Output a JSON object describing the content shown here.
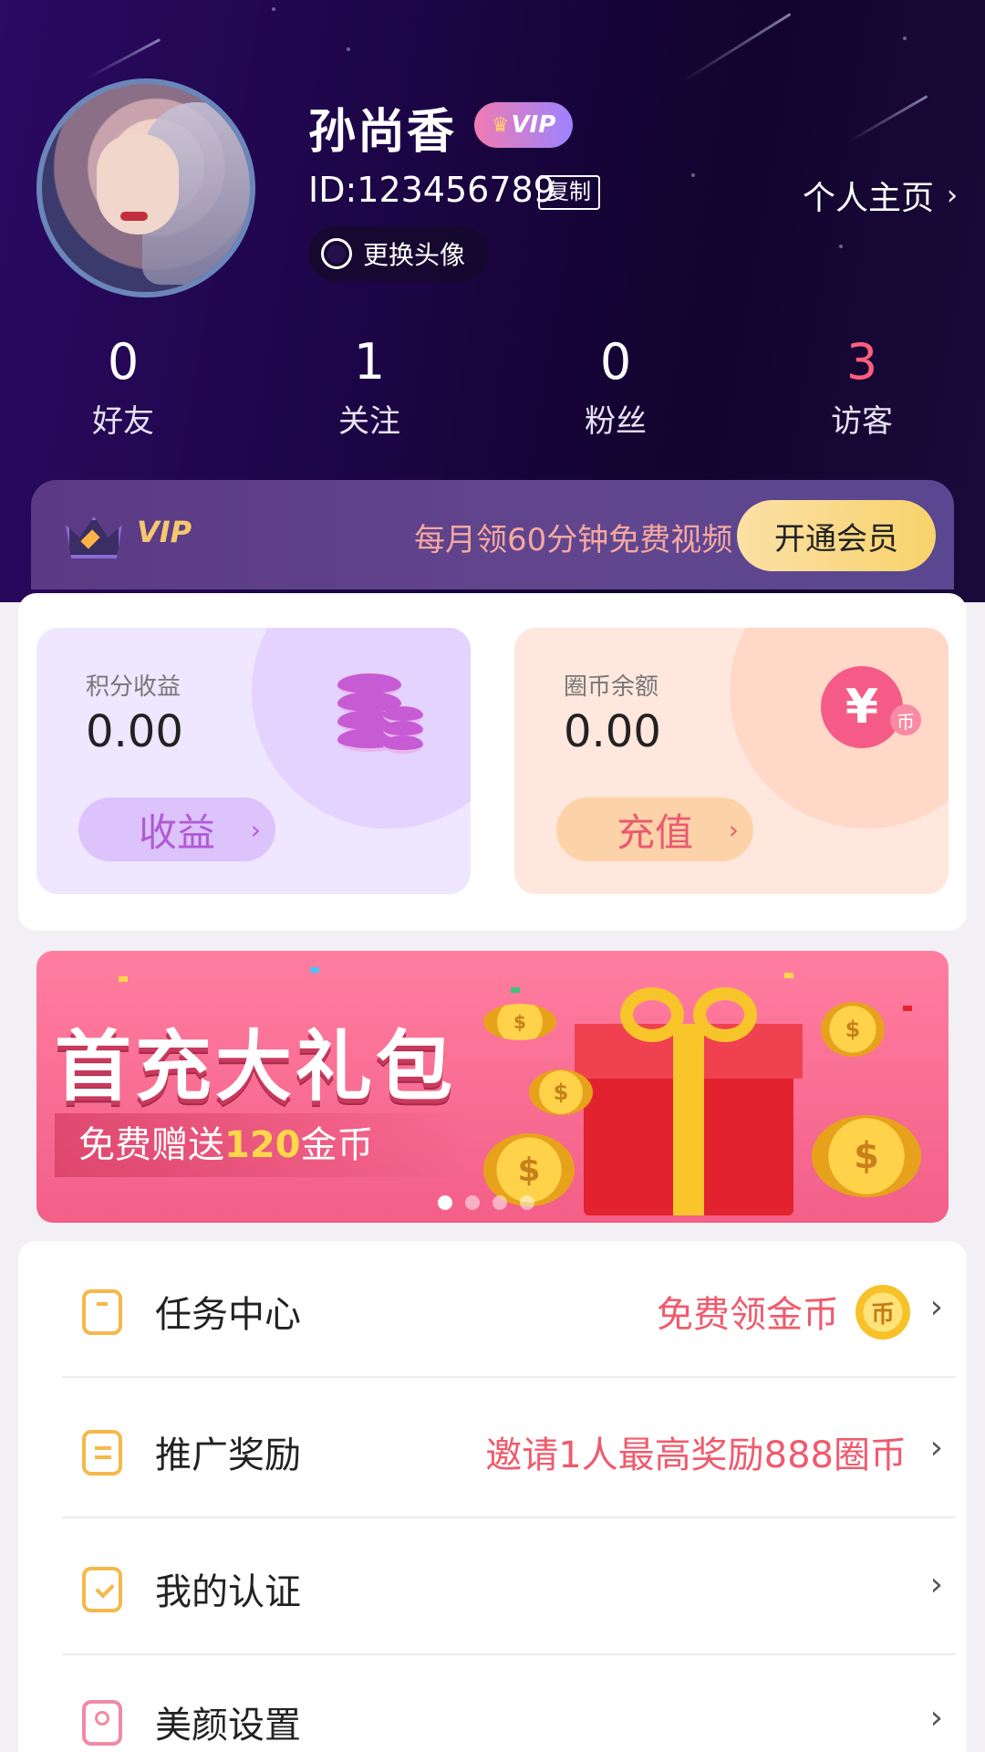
{
  "profile": {
    "name": "孙尚香",
    "vip_badge": "VIP",
    "id_text": "ID:123456789",
    "copy_label": "复制",
    "change_avatar_label": "更换头像",
    "homepage_label": "个人主页"
  },
  "stats": [
    {
      "value": "0",
      "label": "好友"
    },
    {
      "value": "1",
      "label": "关注"
    },
    {
      "value": "0",
      "label": "粉丝"
    },
    {
      "value": "3",
      "label": "访客"
    }
  ],
  "vip_bar": {
    "logo_text": "VIP",
    "promo": "每月领60分钟免费视频",
    "button": "开通会员"
  },
  "wallet": {
    "points": {
      "title": "积分收益",
      "amount": "0.00",
      "button": "收益"
    },
    "coins": {
      "title": "圈币余额",
      "amount": "0.00",
      "button": "充值",
      "icon_glyph": "¥",
      "small_glyph": "币"
    }
  },
  "banner": {
    "headline": "首充大礼包",
    "sub_prefix": "免费赠送",
    "sub_amount": "120",
    "sub_suffix": "金币",
    "slides": 4,
    "active_slide": 0
  },
  "menu": [
    {
      "label": "任务中心",
      "hint": "免费领金币",
      "coin_glyph": "币",
      "icon": "task-icon"
    },
    {
      "label": "推广奖励",
      "hint": "邀请1人最高奖励888圈币",
      "icon": "promo-icon"
    },
    {
      "label": "我的认证",
      "hint": "",
      "icon": "auth-icon"
    },
    {
      "label": "美颜设置",
      "hint": "",
      "icon": "beauty-icon"
    }
  ],
  "colors": {
    "accent_red": "#ef5b6d",
    "vip_gold": "#f8d36b",
    "header_bg": "#1c0545"
  }
}
